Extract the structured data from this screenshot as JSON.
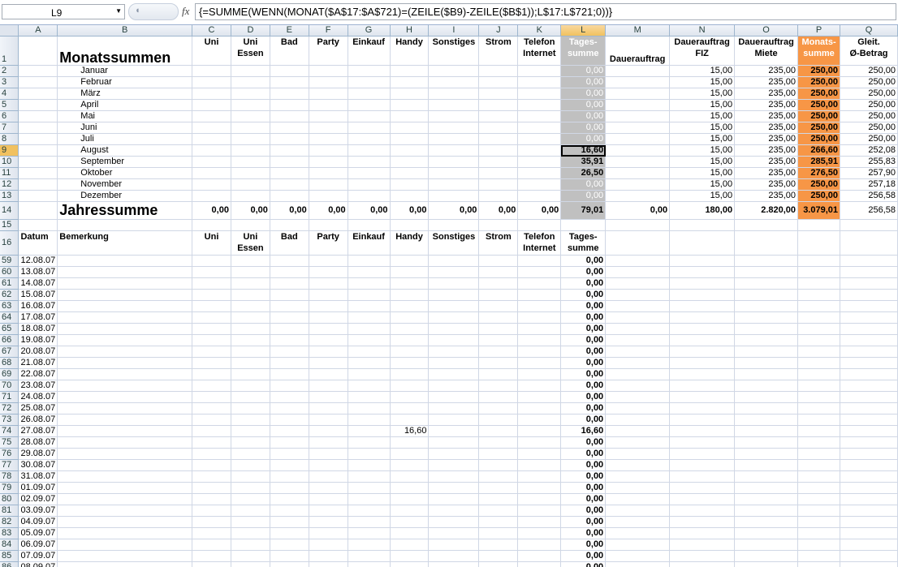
{
  "formula_bar": {
    "name_box": "L9",
    "fx_icon": "fx",
    "formula": "{=SUMME(WENN(MONAT($A$17:$A$721)=(ZEILE($B9)-ZEILE($B$1));L$17:L$721;0))}"
  },
  "columns": [
    "A",
    "B",
    "C",
    "D",
    "E",
    "F",
    "G",
    "H",
    "I",
    "J",
    "K",
    "L",
    "M",
    "N",
    "O",
    "P",
    "Q"
  ],
  "header1": {
    "title": "Monatssummen",
    "c": "Uni",
    "d1": "Uni",
    "d2": "Essen",
    "e": "Bad",
    "f": "Party",
    "g": "Einkauf",
    "h": "Handy",
    "i": "Sonstiges",
    "j": "Strom",
    "k1": "Telefon",
    "k2": "Internet",
    "l1": "Tages-",
    "l2": "summe",
    "m": "Dauerauftrag",
    "n1": "Dauerauftrag",
    "n2": "FIZ",
    "o1": "Dauerauftrag",
    "o2": "Miete",
    "p1": "Monats-",
    "p2": "summe",
    "q1": "Gleit.",
    "q2": "Ø-Betrag"
  },
  "months": [
    {
      "row": "2",
      "name": "Januar",
      "l": "0,00",
      "n": "15,00",
      "o": "235,00",
      "p": "250,00",
      "q": "250,00"
    },
    {
      "row": "3",
      "name": "Februar",
      "l": "0,00",
      "n": "15,00",
      "o": "235,00",
      "p": "250,00",
      "q": "250,00"
    },
    {
      "row": "4",
      "name": "März",
      "l": "0,00",
      "n": "15,00",
      "o": "235,00",
      "p": "250,00",
      "q": "250,00"
    },
    {
      "row": "5",
      "name": "April",
      "l": "0,00",
      "n": "15,00",
      "o": "235,00",
      "p": "250,00",
      "q": "250,00"
    },
    {
      "row": "6",
      "name": "Mai",
      "l": "0,00",
      "n": "15,00",
      "o": "235,00",
      "p": "250,00",
      "q": "250,00"
    },
    {
      "row": "7",
      "name": "Juni",
      "l": "0,00",
      "n": "15,00",
      "o": "235,00",
      "p": "250,00",
      "q": "250,00"
    },
    {
      "row": "8",
      "name": "Juli",
      "l": "0,00",
      "n": "15,00",
      "o": "235,00",
      "p": "250,00",
      "q": "250,00"
    },
    {
      "row": "9",
      "name": "August",
      "l": "16,60",
      "n": "15,00",
      "o": "235,00",
      "p": "266,60",
      "q": "252,08"
    },
    {
      "row": "10",
      "name": "September",
      "l": "35,91",
      "n": "15,00",
      "o": "235,00",
      "p": "285,91",
      "q": "255,83"
    },
    {
      "row": "11",
      "name": "Oktober",
      "l": "26,50",
      "n": "15,00",
      "o": "235,00",
      "p": "276,50",
      "q": "257,90"
    },
    {
      "row": "12",
      "name": "November",
      "l": "0,00",
      "n": "15,00",
      "o": "235,00",
      "p": "250,00",
      "q": "257,18"
    },
    {
      "row": "13",
      "name": "Dezember",
      "l": "0,00",
      "n": "15,00",
      "o": "235,00",
      "p": "250,00",
      "q": "256,58"
    }
  ],
  "year": {
    "row": "14",
    "label": "Jahressumme",
    "c": "0,00",
    "d": "0,00",
    "e": "0,00",
    "f": "0,00",
    "g": "0,00",
    "h": "0,00",
    "i": "0,00",
    "j": "0,00",
    "k": "0,00",
    "l": "79,01",
    "m": "0,00",
    "n": "180,00",
    "o": "2.820,00",
    "p": "3.079,01",
    "q": "256,58"
  },
  "row15": "15",
  "header2": {
    "row": "16",
    "a": "Datum",
    "b": "Bemerkung",
    "c": "Uni",
    "d1": "Uni",
    "d2": "Essen",
    "e": "Bad",
    "f": "Party",
    "g": "Einkauf",
    "h": "Handy",
    "i": "Sonstiges",
    "j": "Strom",
    "k1": "Telefon",
    "k2": "Internet",
    "l1": "Tages-",
    "l2": "summe"
  },
  "daily": [
    {
      "row": "59",
      "date": "12.08.07",
      "h": "",
      "l": "0,00"
    },
    {
      "row": "60",
      "date": "13.08.07",
      "h": "",
      "l": "0,00"
    },
    {
      "row": "61",
      "date": "14.08.07",
      "h": "",
      "l": "0,00"
    },
    {
      "row": "62",
      "date": "15.08.07",
      "h": "",
      "l": "0,00"
    },
    {
      "row": "63",
      "date": "16.08.07",
      "h": "",
      "l": "0,00"
    },
    {
      "row": "64",
      "date": "17.08.07",
      "h": "",
      "l": "0,00"
    },
    {
      "row": "65",
      "date": "18.08.07",
      "h": "",
      "l": "0,00"
    },
    {
      "row": "66",
      "date": "19.08.07",
      "h": "",
      "l": "0,00"
    },
    {
      "row": "67",
      "date": "20.08.07",
      "h": "",
      "l": "0,00"
    },
    {
      "row": "68",
      "date": "21.08.07",
      "h": "",
      "l": "0,00"
    },
    {
      "row": "69",
      "date": "22.08.07",
      "h": "",
      "l": "0,00"
    },
    {
      "row": "70",
      "date": "23.08.07",
      "h": "",
      "l": "0,00"
    },
    {
      "row": "71",
      "date": "24.08.07",
      "h": "",
      "l": "0,00"
    },
    {
      "row": "72",
      "date": "25.08.07",
      "h": "",
      "l": "0,00"
    },
    {
      "row": "73",
      "date": "26.08.07",
      "h": "",
      "l": "0,00"
    },
    {
      "row": "74",
      "date": "27.08.07",
      "h": "16,60",
      "l": "16,60"
    },
    {
      "row": "75",
      "date": "28.08.07",
      "h": "",
      "l": "0,00"
    },
    {
      "row": "76",
      "date": "29.08.07",
      "h": "",
      "l": "0,00"
    },
    {
      "row": "77",
      "date": "30.08.07",
      "h": "",
      "l": "0,00"
    },
    {
      "row": "78",
      "date": "31.08.07",
      "h": "",
      "l": "0,00"
    },
    {
      "row": "79",
      "date": "01.09.07",
      "h": "",
      "l": "0,00"
    },
    {
      "row": "80",
      "date": "02.09.07",
      "h": "",
      "l": "0,00"
    },
    {
      "row": "81",
      "date": "03.09.07",
      "h": "",
      "l": "0,00"
    },
    {
      "row": "82",
      "date": "04.09.07",
      "h": "",
      "l": "0,00"
    },
    {
      "row": "83",
      "date": "05.09.07",
      "h": "",
      "l": "0,00"
    },
    {
      "row": "84",
      "date": "06.09.07",
      "h": "",
      "l": "0,00"
    },
    {
      "row": "85",
      "date": "07.09.07",
      "h": "",
      "l": "0,00"
    },
    {
      "row": "86",
      "date": "08.09.07",
      "h": "",
      "l": "0,00"
    }
  ],
  "colors": {
    "selected_header": "#f1c15f",
    "total_column": "#c0c0c0",
    "month_sum_column": "#f79646"
  }
}
